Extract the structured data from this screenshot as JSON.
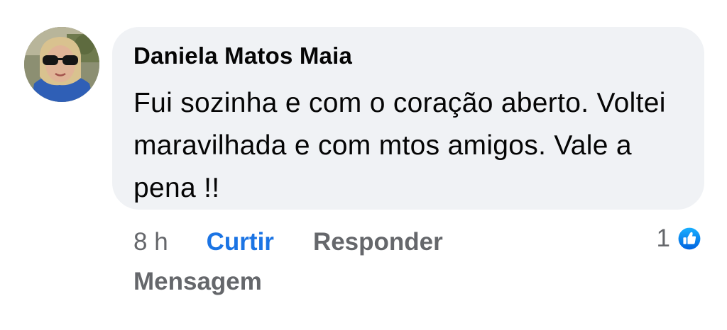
{
  "comment": {
    "author": "Daniela Matos Maia",
    "text": "Fui sozinha e com o coração aberto. Voltei maravilhada e com mtos amigos. Vale a pena !!",
    "avatar_icon": "profile-photo"
  },
  "actions": {
    "time": "8 h",
    "like_label": "Curtir",
    "reply_label": "Responder",
    "message_label": "Mensagem"
  },
  "reactions": {
    "count": "1",
    "icon": "like-thumbs-up-icon"
  },
  "colors": {
    "bubble": "#f0f2f5",
    "accent_blue": "#1b74e4",
    "secondary_text": "#65676b",
    "primary_text": "#050505"
  }
}
